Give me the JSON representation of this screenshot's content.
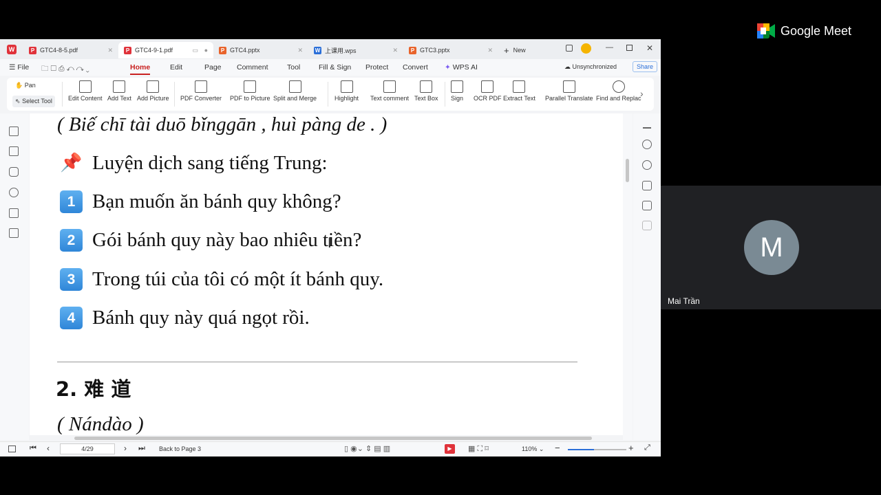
{
  "meet": {
    "brand": "Google Meet",
    "participant_initial": "M",
    "participant_name": "Mai Trần"
  },
  "tabs": [
    {
      "label": "GTC4-8-5.pdf",
      "type": "pdf"
    },
    {
      "label": "GTC4-9-1.pdf",
      "type": "pdf",
      "active": true
    },
    {
      "label": "GTC4.pptx",
      "type": "ppt"
    },
    {
      "label": "上课用.wps",
      "type": "doc"
    },
    {
      "label": "GTC3.pptx",
      "type": "ppt"
    }
  ],
  "tab_new": "New",
  "menu": {
    "file": "File",
    "items": [
      "Home",
      "Edit",
      "Page",
      "Comment",
      "Tool",
      "Fill & Sign",
      "Protect",
      "Convert",
      "WPS AI"
    ],
    "sync": "Unsynchronized",
    "share": "Share"
  },
  "ribbon": {
    "pan": "Pan",
    "select": "Select Tool",
    "buttons": [
      "Edit Content",
      "Add Text",
      "Add Picture",
      "PDF Converter",
      "PDF to Picture",
      "Split and Merge",
      "Highlight",
      "Text comment",
      "Text Box",
      "Sign",
      "OCR PDF",
      "Extract Text",
      "Parallel Translate",
      "Find and Replac"
    ]
  },
  "document": {
    "pinyin_line": "( Biế chī tài duō bǐnggān , huì pàng de . )",
    "heading": "Luyện dịch sang tiếng Trung:",
    "items": [
      {
        "n": "1",
        "text": "Bạn muốn ăn bánh quy không?"
      },
      {
        "n": "2",
        "text": "Gói bánh quy này bao nhiêu tiền?"
      },
      {
        "n": "3",
        "text": "Trong túi của tôi có một ít bánh quy."
      },
      {
        "n": "4",
        "text": "Bánh quy này quá ngọt rồi."
      }
    ],
    "section": "2. 难 道",
    "section_pinyin": "( Nándào )"
  },
  "status": {
    "page": "4/29",
    "back": "Back to Page 3",
    "zoom": "110%"
  }
}
